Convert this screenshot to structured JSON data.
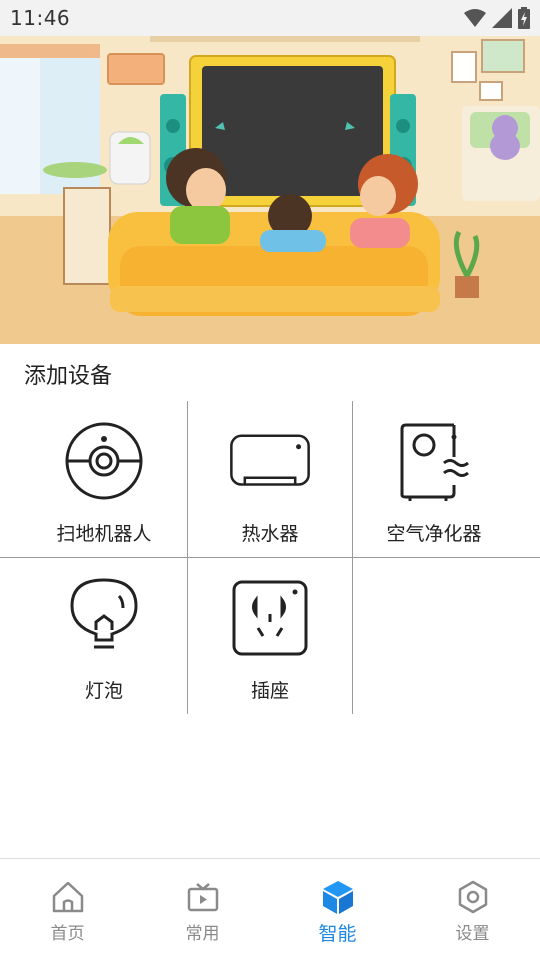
{
  "status_bar": {
    "time": "11:46",
    "icons": [
      "wifi-icon",
      "cellular-signal-icon",
      "battery-charging-icon"
    ]
  },
  "banner": {
    "description_icon": "family-watching-tv-illustration"
  },
  "section": {
    "title": "添加设备"
  },
  "devices": [
    {
      "label": "扫地机器人",
      "icon": "robot-vacuum-icon"
    },
    {
      "label": "热水器",
      "icon": "water-heater-icon"
    },
    {
      "label": "空气净化器",
      "icon": "air-purifier-icon"
    },
    {
      "label": "灯泡",
      "icon": "light-bulb-icon"
    },
    {
      "label": "插座",
      "icon": "power-socket-icon"
    }
  ],
  "nav": {
    "items": [
      {
        "label": "首页",
        "icon": "home-icon",
        "active": false
      },
      {
        "label": "常用",
        "icon": "tv-icon",
        "active": false
      },
      {
        "label": "智能",
        "icon": "cube-icon",
        "active": true
      },
      {
        "label": "设置",
        "icon": "settings-hexagon-icon",
        "active": false
      }
    ],
    "active_color": "#1e88e5",
    "inactive_color": "#8a8a8a"
  }
}
